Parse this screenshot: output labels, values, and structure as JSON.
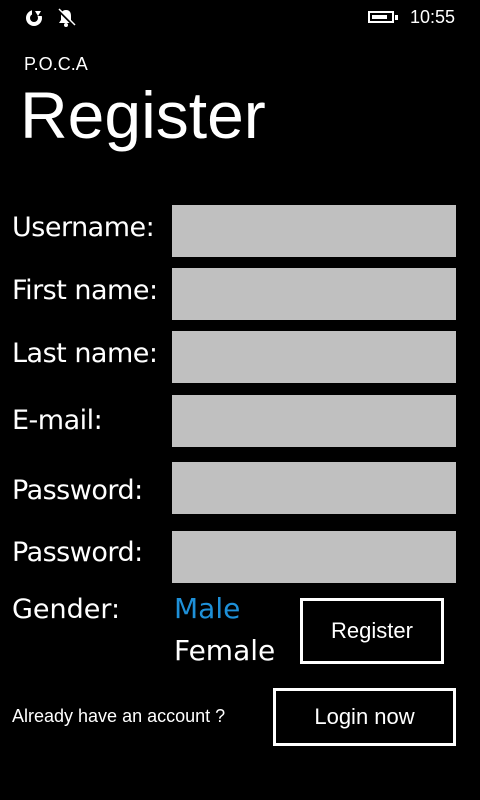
{
  "status_bar": {
    "time": "10:55",
    "battery_level": 0.85,
    "icons": [
      "sync-icon",
      "bell-icon",
      "battery-icon"
    ]
  },
  "app": {
    "name": "P.O.C.A",
    "page_title": "Register"
  },
  "form": {
    "fields": [
      {
        "label": "Username:",
        "value": ""
      },
      {
        "label": "First name:",
        "value": ""
      },
      {
        "label": "Last name:",
        "value": ""
      },
      {
        "label": "E-mail:",
        "value": ""
      },
      {
        "label": "Password:",
        "value": ""
      },
      {
        "label": "Password:",
        "value": ""
      }
    ],
    "gender": {
      "label": "Gender:",
      "options": [
        "Male",
        "Female"
      ],
      "selected": "Male"
    },
    "register_label": "Register"
  },
  "footer": {
    "prompt": "Already have an account ?",
    "login_label": "Login now"
  },
  "colors": {
    "background": "#000000",
    "input_background": "#c0c0c0",
    "accent": "#1e90d8",
    "text": "#ffffff"
  }
}
